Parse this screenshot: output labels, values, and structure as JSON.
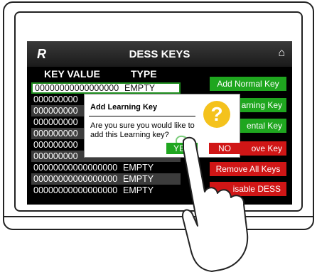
{
  "header": {
    "logo": "R",
    "title": "DESS KEYS",
    "home_icon": "home-icon"
  },
  "table": {
    "col_key": "KEY VALUE",
    "col_type": "TYPE",
    "rows": [
      {
        "value": "00000000000000000",
        "type": "EMPTY"
      },
      {
        "value": "000000000",
        "type": ""
      },
      {
        "value": "000000000",
        "type": ""
      },
      {
        "value": "000000000",
        "type": ""
      },
      {
        "value": "000000000",
        "type": ""
      },
      {
        "value": "000000000",
        "type": ""
      },
      {
        "value": "000000000",
        "type": ""
      },
      {
        "value": "00000000000000000",
        "type": "EMPTY"
      },
      {
        "value": "00000000000000000",
        "type": "EMPTY"
      },
      {
        "value": "00000000000000000",
        "type": "EMPTY"
      }
    ]
  },
  "buttons": {
    "add_normal": "Add Normal Key",
    "add_learning": "arning Key",
    "add_rental": "ental Key",
    "remove": "ove Key",
    "remove_all": "Remove All Keys",
    "disable": "isable DESS"
  },
  "dialog": {
    "title": "Add Learning Key",
    "message_line1": "Are you sure you would like to",
    "message_line2": "add this Learning key?",
    "yes": "YES",
    "no": "NO"
  },
  "colors": {
    "green": "#1fa61f",
    "red": "#d01616",
    "warning": "#f4c21d"
  }
}
